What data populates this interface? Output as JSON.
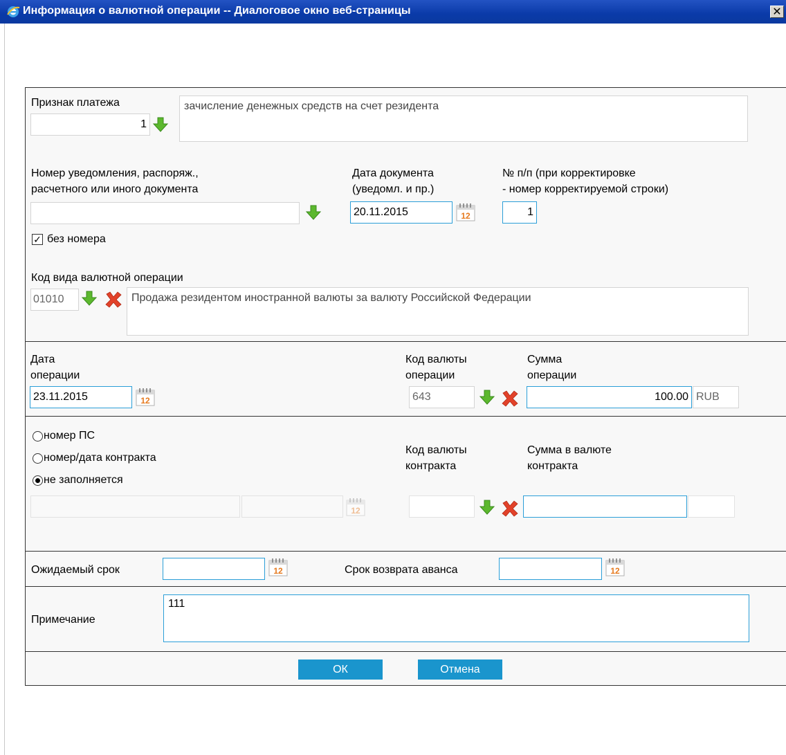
{
  "window": {
    "title": "Информация о валютной операции -- Диалоговое окно веб-страницы",
    "close_glyph": "✕"
  },
  "payment": {
    "label": "Признак платежа",
    "code": "1",
    "description": "зачисление денежных средств на счет резидента"
  },
  "notice": {
    "label_line1": "Номер уведомления, распоряж.,",
    "label_line2": "расчетного или иного документа",
    "number": "",
    "no_number_label": "без номера",
    "no_number_checked": true
  },
  "doc_date": {
    "label_line1": "Дата документа",
    "label_line2": "(уведомл. и пр.)",
    "value": "20.11.2015"
  },
  "row_num": {
    "label_line1": "№ п/п (при корректировке",
    "label_line2": "- номер корректируемой строки)",
    "value": "1"
  },
  "op_code": {
    "label": "Код вида валютной операции",
    "code": "01010",
    "description": "Продажа резидентом иностранной валюты за валюту Российской Федерации"
  },
  "operation": {
    "date_label_line1": "Дата",
    "date_label_line2": "операции",
    "date": "23.11.2015",
    "currency_label_line1": "Код валюты",
    "currency_label_line2": "операции",
    "currency": "643",
    "amount_label_line1": "Сумма",
    "amount_label_line2": "операции",
    "amount": "100.00",
    "amount_currency": "RUB"
  },
  "contract": {
    "radio_ps": "номер ПС",
    "radio_contract": "номер/дата контракта",
    "radio_none": "не заполняется",
    "selected": "none",
    "currency_label_line1": "Код валюты",
    "currency_label_line2": "контракта",
    "amount_label_line1": "Сумма в валюте",
    "amount_label_line2": "контракта"
  },
  "terms": {
    "expected_label": "Ожидаемый срок",
    "advance_label": "Срок возврата аванса"
  },
  "note": {
    "label": "Примечание",
    "value": "111"
  },
  "buttons": {
    "ok": "ОК",
    "cancel": "Отмена"
  },
  "icons": {
    "arrow": "green-arrow-down-icon",
    "delete": "red-x-icon",
    "calendar": "calendar-icon",
    "ie": "ie-logo-icon"
  },
  "colors": {
    "titlebar": "#0a3aa8",
    "accent_border": "#2a9ed8",
    "button": "#1a95cd",
    "arrow": "#5cb82e",
    "delete": "#e2422a"
  }
}
